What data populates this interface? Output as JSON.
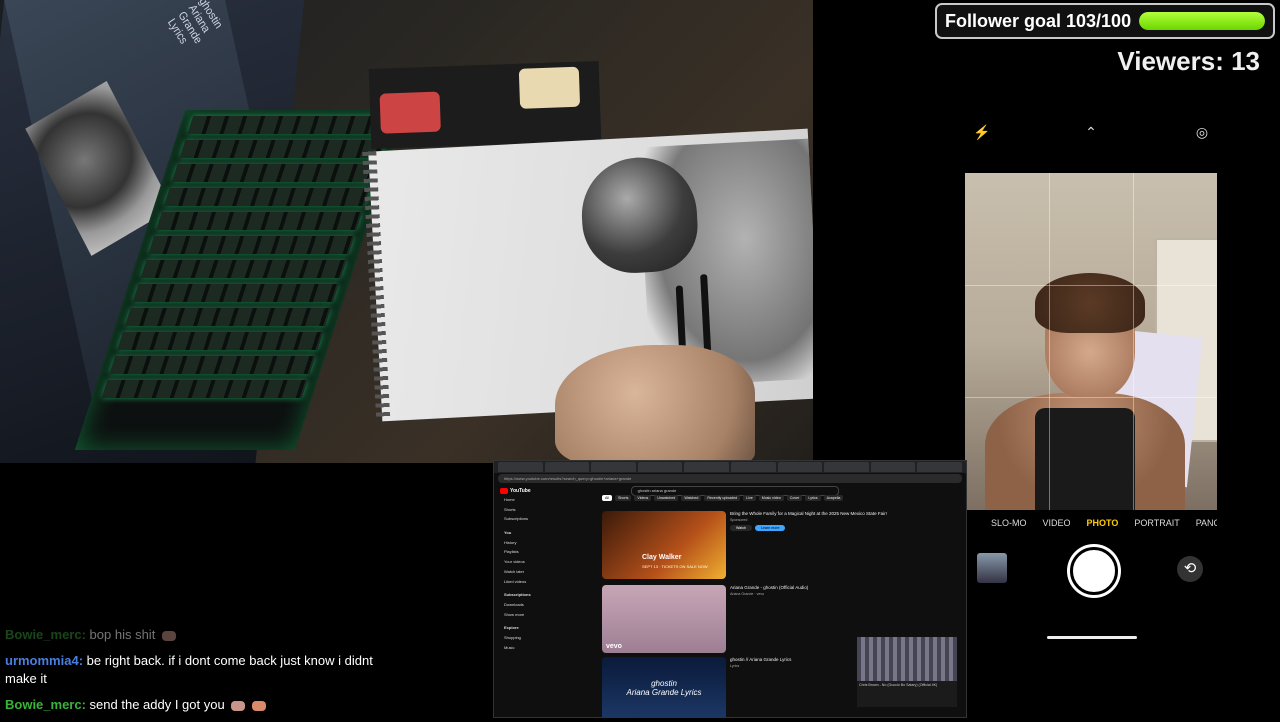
{
  "overlay": {
    "goal_label": "Follower goal 103/100",
    "goal_progress": 1.0,
    "viewers": "Viewers: 13",
    "accent_color": "#8cf21a"
  },
  "webcam": {
    "laptop_text": "ghostin Ariana Grande Lyrics"
  },
  "phone_camera": {
    "modes": [
      "SLO-MO",
      "VIDEO",
      "PHOTO",
      "PORTRAIT",
      "PANO"
    ],
    "active_mode": "PHOTO",
    "icons": {
      "flash": "flash-off-icon",
      "chevron": "chevron-up-icon",
      "live": "live-photo-off-icon",
      "flip": "camera-flip-icon"
    }
  },
  "chat": [
    {
      "user": "Bowie_merc:",
      "text": "bop his shit",
      "color": "#3a9a3a",
      "faded": true,
      "emote": true
    },
    {
      "user": "urmommia4:",
      "text": "be right back. if i dont come back just know i didnt make it",
      "color": "#4a7fe0",
      "faded": false,
      "emote": false
    },
    {
      "user": "Bowie_merc:",
      "text": "send the addy I got you",
      "color": "#3ab33a",
      "faded": false,
      "emote": true
    }
  ],
  "browser": {
    "url": "https://www.youtube.com/results?search_query=ghostin+ariana+grande",
    "search_query": "ghostin ariana grande",
    "logo": "YouTube",
    "sidebar": [
      "Home",
      "Shorts",
      "Subscriptions",
      "You",
      "History",
      "Playlists",
      "Your videos",
      "Watch later",
      "Liked videos",
      "Subscriptions",
      "Downloads",
      "Show more",
      "Explore",
      "Shopping",
      "Music"
    ],
    "chips": [
      "All",
      "Shorts",
      "Videos",
      "Unwatched",
      "Watched",
      "Recently uploaded",
      "Live",
      "Music video",
      "Cover",
      "Lyrics",
      "Acapella"
    ],
    "videos": [
      {
        "title": "Bring the Whole Family for a Magical Night at the 2025 New Mexico State Fair!",
        "sub": "Sponsored",
        "thumb_title": "Clay Walker",
        "thumb_sub": "SEPT 13 · TICKETS ON SALE NOW",
        "btn1": "Watch",
        "btn2": "Learn more"
      },
      {
        "title": "Ariana Grande - ghostin (Official Audio)",
        "sub": "Ariana Grande · vevo",
        "thumb_label": "vevo"
      },
      {
        "title": "ghostin // Ariana Grande Lyrics",
        "sub": "Lyrics",
        "thumb_text": "ghostin\nAriana Grande Lyrics"
      }
    ],
    "mini_player_text": "Chris Brown - No (Guccio Bo Salary) (Official 4K)"
  }
}
